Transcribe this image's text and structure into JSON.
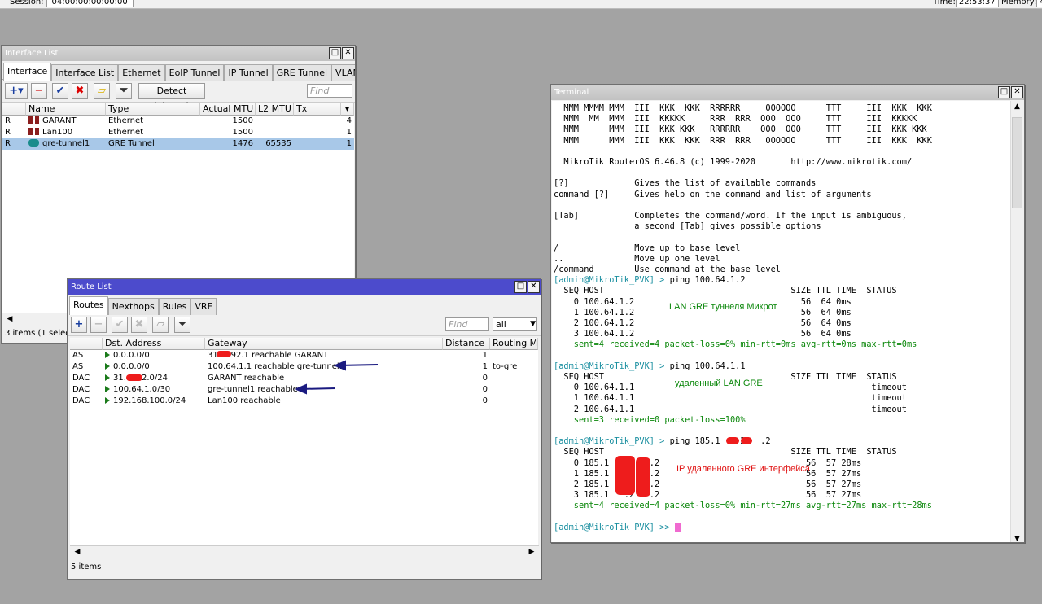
{
  "topbar": {
    "session_label": "Session:",
    "session_value": "04:00:00:00:00:00",
    "time_label": "Time:",
    "time_value": "22:53:37",
    "memory_label": "Memory:",
    "memory_value": "49"
  },
  "iflist": {
    "title": "Interface List",
    "tabs": [
      "Interface",
      "Interface List",
      "Ethernet",
      "EoIP Tunnel",
      "IP Tunnel",
      "GRE Tunnel",
      "VLAN",
      "..."
    ],
    "detect_label": "Detect Internet",
    "find_placeholder": "Find",
    "headers": [
      "",
      "Name",
      "Type",
      "Actual MTU",
      "L2 MTU",
      "Tx"
    ],
    "rows": [
      {
        "flag": "R",
        "name": "GARANT",
        "type": "Ethernet",
        "mtu": "1500",
        "l2mtu": "",
        "tx": "4"
      },
      {
        "flag": "R",
        "name": "Lan100",
        "type": "Ethernet",
        "mtu": "1500",
        "l2mtu": "",
        "tx": "1"
      },
      {
        "flag": "R",
        "name": "gre-tunnel1",
        "type": "GRE Tunnel",
        "mtu": "1476",
        "l2mtu": "65535",
        "tx": "1"
      }
    ],
    "status": "3 items (1 selected)"
  },
  "routelist": {
    "title": "Route List",
    "tabs": [
      "Routes",
      "Nexthops",
      "Rules",
      "VRF"
    ],
    "find_placeholder": "Find",
    "filter_value": "all",
    "headers": [
      "",
      "Dst. Address",
      "Gateway",
      "Distance",
      "Routing Mark"
    ],
    "rows": [
      {
        "flag": "AS",
        "dst": "0.0.0.0/0",
        "gw": "31.  .192.1 reachable GARANT",
        "dist": "1",
        "mark": ""
      },
      {
        "flag": "AS",
        "dst": "0.0.0.0/0",
        "gw": "100.64.1.1 reachable gre-tunnel1",
        "dist": "1",
        "mark": "to-gre"
      },
      {
        "flag": "DAC",
        "dst": "31.   .192.0/24",
        "gw": "GARANT reachable",
        "dist": "0",
        "mark": ""
      },
      {
        "flag": "DAC",
        "dst": "100.64.1.0/30",
        "gw": "gre-tunnel1 reachable",
        "dist": "0",
        "mark": ""
      },
      {
        "flag": "DAC",
        "dst": "192.168.100.0/24",
        "gw": "Lan100 reachable",
        "dist": "0",
        "mark": ""
      }
    ],
    "status": "5 items"
  },
  "terminal": {
    "title": "Terminal",
    "banner": [
      "  MMM MMMM MMM  III  KKK  KKK  RRRRRR     OOOOOO      TTT     III  KKK  KKK",
      "  MMM  MM  MMM  III  KKKKK     RRR  RRR  OOO  OOO     TTT     III  KKKKK",
      "  MMM      MMM  III  KKK KKK   RRRRRR    OOO  OOO     TTT     III  KKK KKK",
      "  MMM      MMM  III  KKK  KKK  RRR  RRR   OOOOOO      TTT     III  KKK  KKK",
      "",
      "  MikroTik RouterOS 6.46.8 (c) 1999-2020       http://www.mikrotik.com/",
      "",
      "[?]             Gives the list of available commands",
      "command [?]     Gives help on the command and list of arguments",
      "",
      "[Tab]           Completes the command/word. If the input is ambiguous,",
      "                a second [Tab] gives possible options",
      "",
      "/               Move up to base level",
      "..              Move up one level",
      "/command        Use command at the base level"
    ],
    "prompt": "[admin@MikroTik_PVK] > ",
    "ping1": {
      "cmd": "ping 100.64.1.2",
      "header": "  SEQ HOST                                     SIZE TTL TIME  STATUS",
      "rows": [
        "    0 100.64.1.2                                 56  64 0ms",
        "    1 100.64.1.2                                 56  64 0ms",
        "    2 100.64.1.2                                 56  64 0ms",
        "    3 100.64.1.2                                 56  64 0ms"
      ],
      "summary": "    sent=4 received=4 packet-loss=0% min-rtt=0ms avg-rtt=0ms max-rtt=0ms"
    },
    "ping2": {
      "cmd": "ping 100.64.1.1",
      "header": "  SEQ HOST                                     SIZE TTL TIME  STATUS",
      "rows": [
        "    0 100.64.1.1                                               timeout",
        "    1 100.64.1.1                                               timeout",
        "    2 100.64.1.1                                               timeout"
      ],
      "summary": "    sent=3 received=0 packet-loss=100%"
    },
    "ping3": {
      "cmd": "ping 185.1   .2   .2",
      "header": "  SEQ HOST                                     SIZE TTL TIME  STATUS",
      "rows": [
        "    0 185.1   .2   .2                             56  57 28ms",
        "    1 185.1   .2   .2                             56  57 27ms",
        "    2 185.1   .2   .2                             56  57 27ms",
        "    3 185.1   .2   .2                             56  57 27ms"
      ],
      "summary": "    sent=4 received=4 packet-loss=0% min-rtt=27ms avg-rtt=27ms max-rtt=28ms"
    },
    "final_prompt": "[admin@MikroTik_PVK] >> "
  },
  "notes": {
    "lan_gre": "LAN GRE туннеля Микрот",
    "remote_lan": "удаленный LAN GRE",
    "ip_remote": "IP удаленного GRE интерфейса"
  },
  "colors": {
    "prompt": "#1a8fa0",
    "summary": "#0a870a",
    "annotation_red": "#ee1c1c",
    "arrow": "#1a1a80"
  }
}
